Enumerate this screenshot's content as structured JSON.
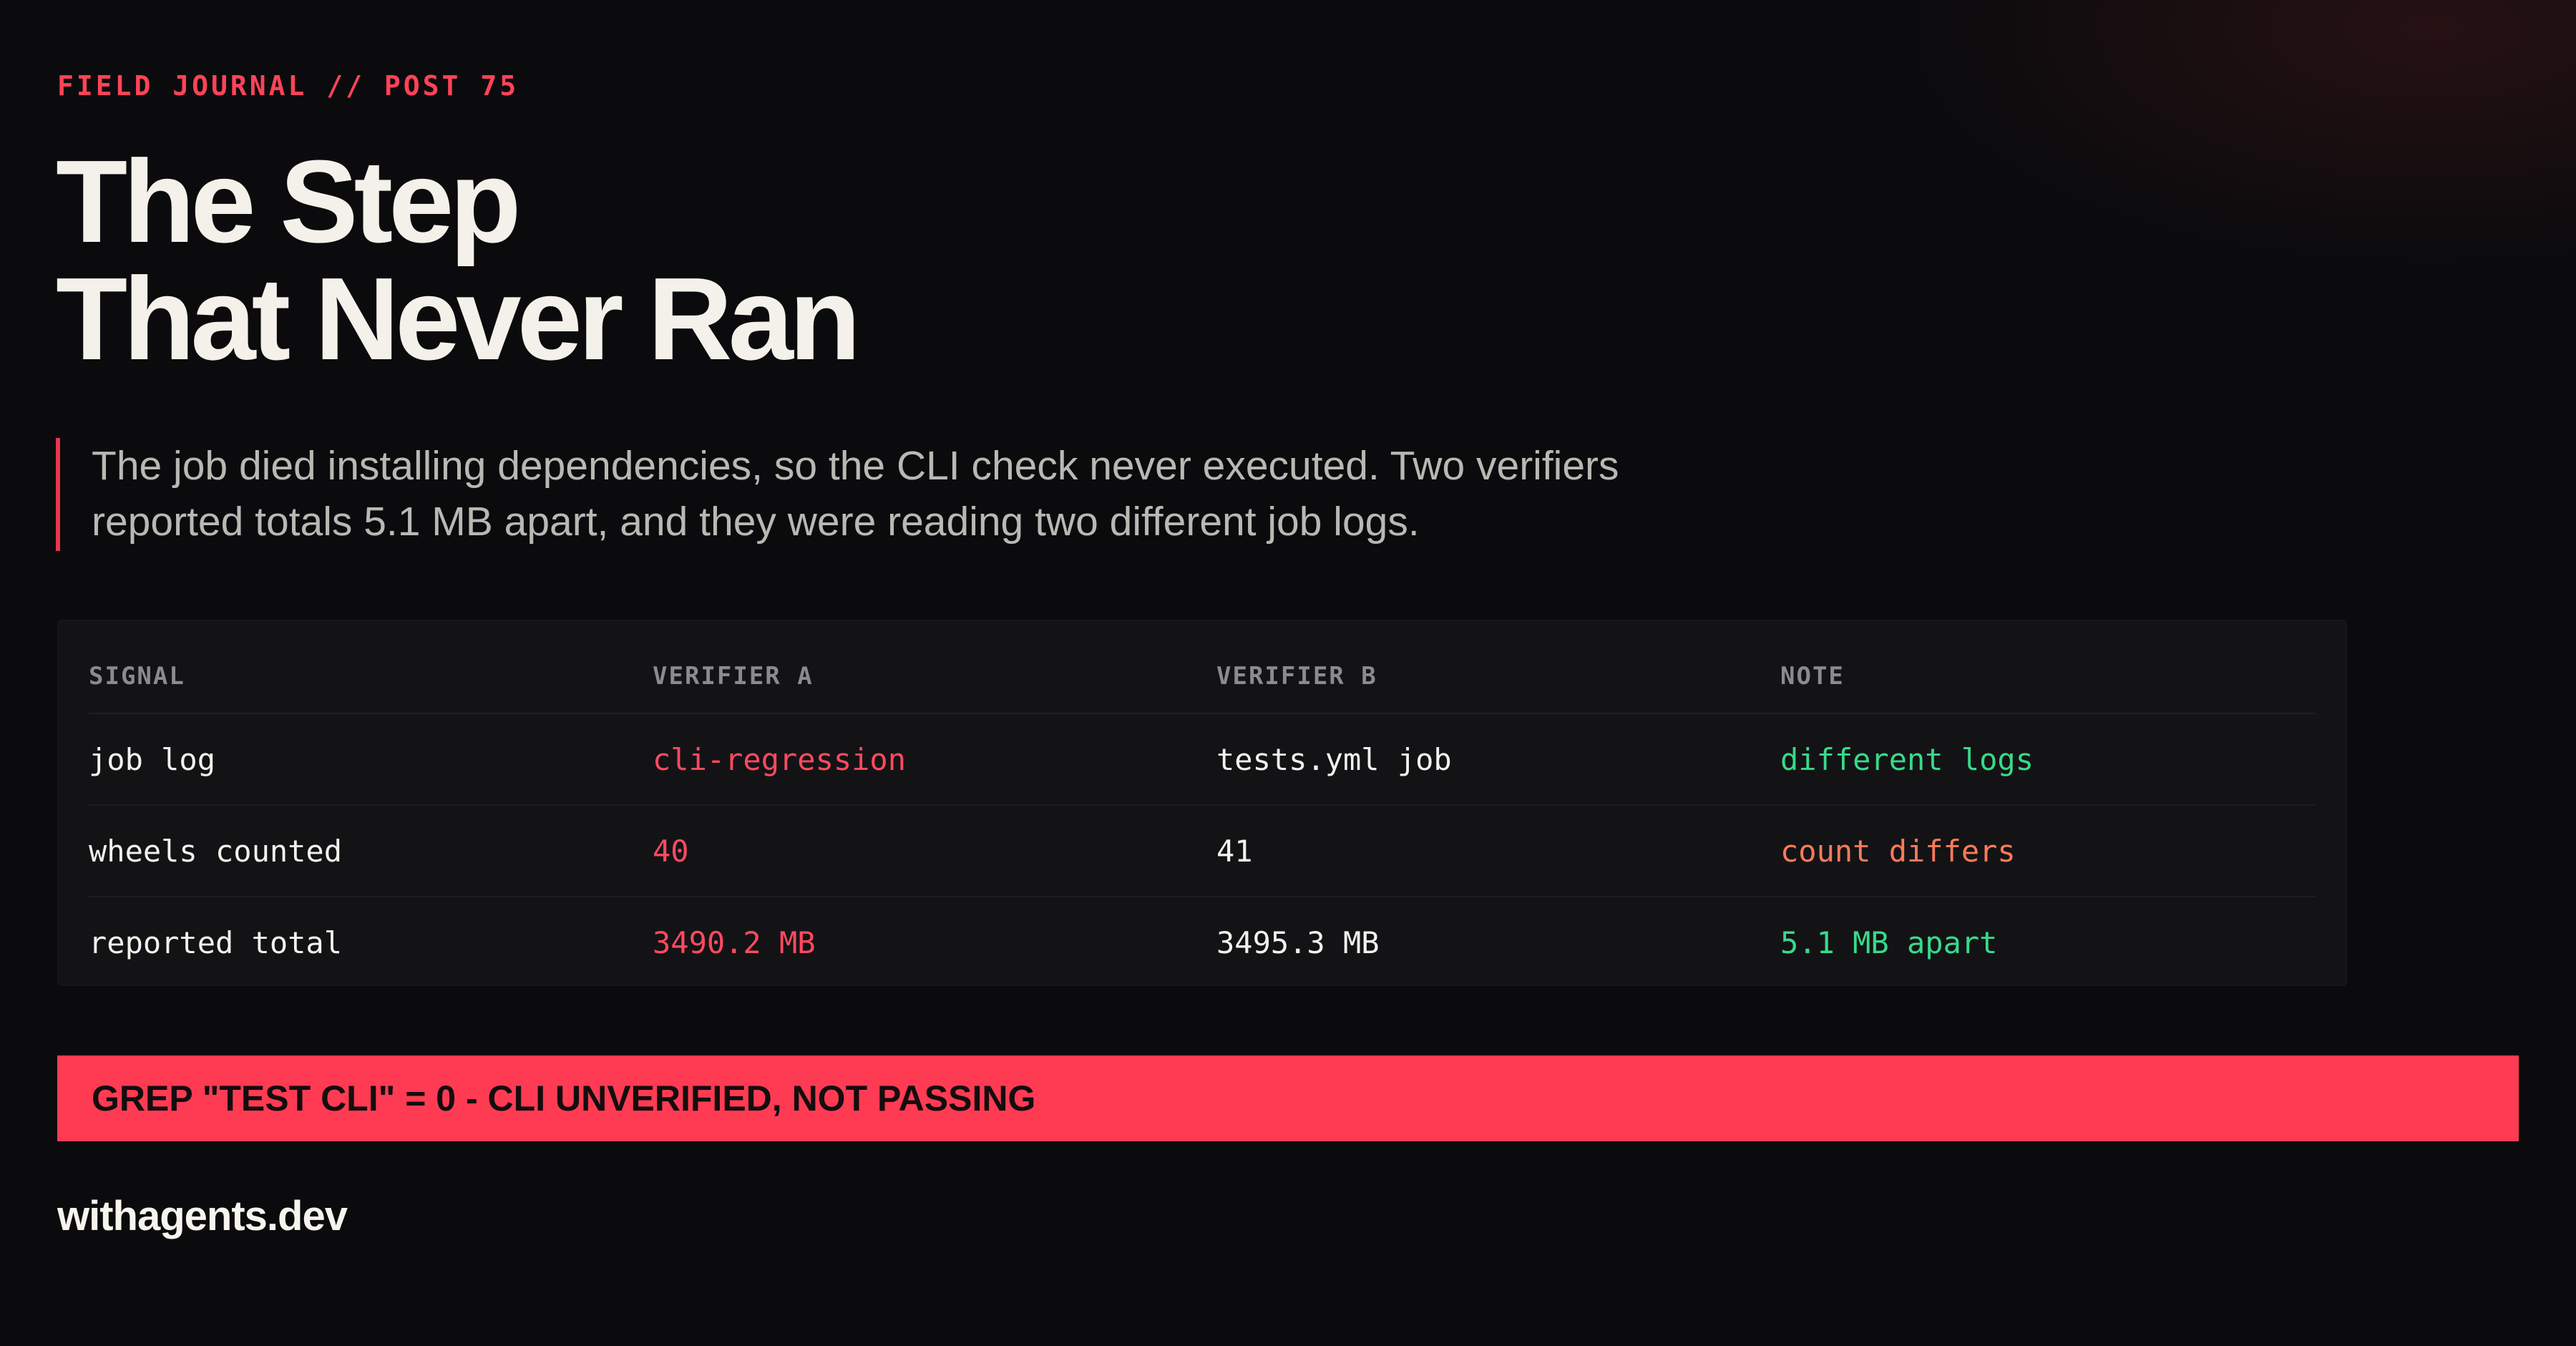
{
  "header": {
    "kicker": "FIELD JOURNAL // POST 75",
    "title_lines": [
      "The Step",
      "That Never Ran"
    ]
  },
  "lede": "The job died installing dependencies, so the CLI check never executed. Two verifiers reported totals 5.1 MB apart, and they were reading two different job logs.",
  "table": {
    "columns": [
      "SIGNAL",
      "VERIFIER A",
      "VERIFIER B",
      "NOTE"
    ],
    "rows": [
      [
        "job log",
        "cli-regression",
        "tests.yml job",
        "different logs"
      ],
      [
        "wheels counted",
        "40",
        "41",
        "count differs"
      ],
      [
        "reported total",
        "3490.2 MB",
        "3495.3 MB",
        "5.1 MB apart"
      ]
    ]
  },
  "banner": "GREP \"TEST CLI\" = 0 - CLI UNVERIFIED, NOT PASSING",
  "footer": "withagents.dev",
  "colors": {
    "background": "#0b0b0d",
    "accent_red": "#ff3b53",
    "kicker_red": "#ff4358",
    "verifier_a_red": "#ff4a5f",
    "note_green": "#39d98a",
    "note_orange": "#ff7a59",
    "text_primary": "#f4f1ea",
    "text_muted": "#b9b8b3",
    "table_header": "#8a8a8f"
  }
}
